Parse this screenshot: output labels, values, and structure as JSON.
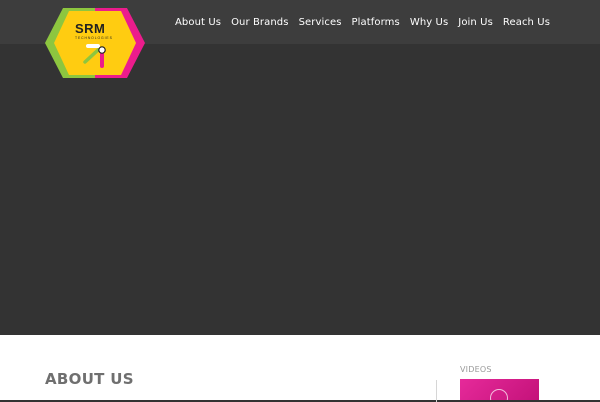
{
  "colors": {
    "header_background": "#3d3d3d",
    "hero_background": "#333333",
    "content_background": "#ffffff",
    "nav_text": "#ffffff",
    "heading_text": "#6f6f6f",
    "video_thumbnail": "#e62a9a",
    "logo_green": "#8dc63f",
    "logo_pink": "#ec1c8c",
    "logo_yellow": "#ffcc11"
  },
  "logo": {
    "brand": "SRM",
    "tagline": "TECHNOLOGIES"
  },
  "nav": {
    "items": [
      {
        "label": "About Us"
      },
      {
        "label": "Our Brands"
      },
      {
        "label": "Services"
      },
      {
        "label": "Platforms"
      },
      {
        "label": "Why Us"
      },
      {
        "label": "Join Us"
      },
      {
        "label": "Reach Us"
      }
    ]
  },
  "about": {
    "title": "ABOUT US"
  },
  "sidebar": {
    "videos_label": "VIDEOS",
    "video_icon": "play-icon"
  }
}
